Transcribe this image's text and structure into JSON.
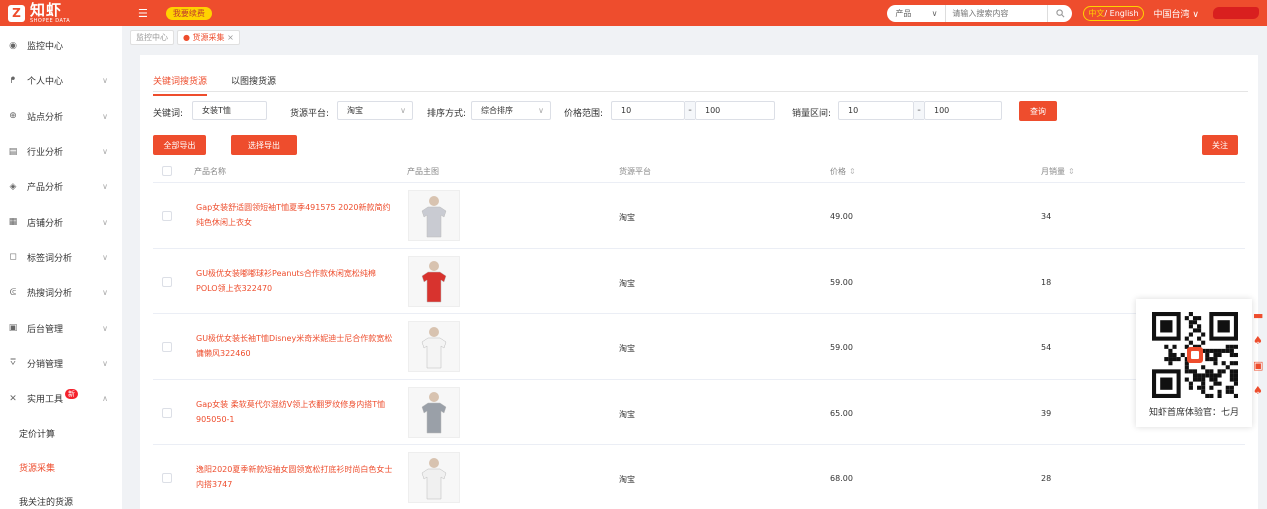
{
  "topbar": {
    "logo_text": "知虾",
    "logo_sub": "SHOPEE DATA",
    "promo_label": "我要续费",
    "search_select": "产品",
    "search_placeholder": "请输入搜索内容",
    "lang_zh": "中文",
    "lang_en": "/ English",
    "region": "中国台湾 ∨"
  },
  "sidebar": {
    "items": [
      {
        "label": "监控中心",
        "icon": "monitor-icon"
      },
      {
        "label": "个人中心",
        "icon": "user-icon",
        "chev": "∨"
      },
      {
        "label": "站点分析",
        "icon": "globe-icon",
        "chev": "∨"
      },
      {
        "label": "行业分析",
        "icon": "industry-icon",
        "chev": "∨"
      },
      {
        "label": "产品分析",
        "icon": "box-icon",
        "chev": "∨"
      },
      {
        "label": "店铺分析",
        "icon": "store-icon",
        "chev": "∨"
      },
      {
        "label": "标签词分析",
        "icon": "tag-icon",
        "chev": "∨"
      },
      {
        "label": "热搜词分析",
        "icon": "fire-icon",
        "chev": "∨"
      },
      {
        "label": "后台管理",
        "icon": "admin-icon",
        "chev": "∨"
      },
      {
        "label": "分销管理",
        "icon": "distribution-icon",
        "chev": "∨"
      },
      {
        "label": "实用工具",
        "icon": "tool-icon",
        "chev": "∧",
        "badge": "新"
      }
    ],
    "subitems": [
      "定价计算",
      "货源采集",
      "我关注的货源"
    ]
  },
  "breadcrumb": {
    "home": "监控中心",
    "current": "货源采集"
  },
  "tabs": [
    "关键词搜货源",
    "以图搜货源"
  ],
  "filters": {
    "keyword_label": "关键词:",
    "keyword_value": "女装T恤",
    "platform_label": "货源平台:",
    "platform_value": "淘宝",
    "sort_label": "排序方式:",
    "sort_value": "综合排序",
    "price_label": "价格范围:",
    "price_min": "10",
    "price_max": "100",
    "sales_label": "销量区间:",
    "sales_min": "10",
    "sales_max": "100",
    "query_button": "查询"
  },
  "actions": {
    "export_all": "全部导出",
    "export_selected": "选择导出",
    "follow": "关注"
  },
  "table": {
    "headers": {
      "name": "产品名称",
      "image": "产品主图",
      "platform": "货源平台",
      "price": "价格",
      "sales": "月销量"
    },
    "rows": [
      {
        "name": "Gap女装舒适圆领短袖T恤夏季491575 2020新款简约纯色休闲上衣女",
        "platform": "淘宝",
        "price": "49.00",
        "sales": "34"
      },
      {
        "name": "GU极优女装嘟嘟球衫Peanuts合作款休闲宽松纯棉POLO领上衣322470",
        "platform": "淘宝",
        "price": "59.00",
        "sales": "18"
      },
      {
        "name": "GU极优女装长袖T恤Disney米奇米妮迪士尼合作款宽松慵懒风322460",
        "platform": "淘宝",
        "price": "59.00",
        "sales": "54"
      },
      {
        "name": "Gap女装 柔软莫代尔混纺V领上衣翻罗纹修身内搭T恤905050-1",
        "platform": "淘宝",
        "price": "65.00",
        "sales": "39"
      },
      {
        "name": "逸阳2020夏季新款短袖女圆领宽松打底衫时尚白色女士内搭3747",
        "platform": "淘宝",
        "price": "68.00",
        "sales": "28"
      }
    ]
  },
  "qr_caption": "知虾首席体验官：七月",
  "colors": {
    "brand": "#ee4d2d",
    "promo": "#ffd200"
  }
}
